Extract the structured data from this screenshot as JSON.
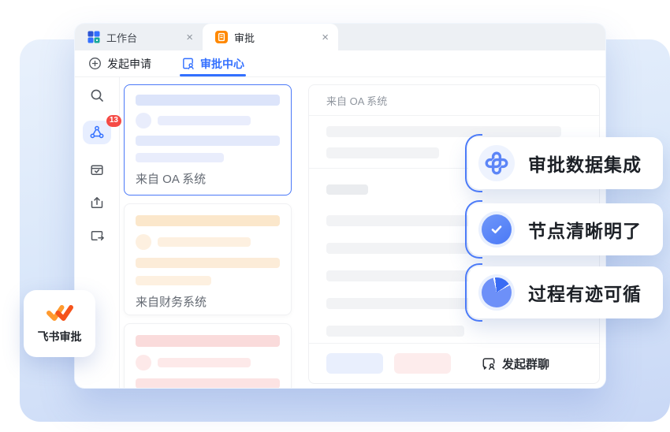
{
  "tabs": {
    "workbench": {
      "label": "工作台",
      "close": "×"
    },
    "approval": {
      "label": "审批",
      "close": "×"
    }
  },
  "subnav": {
    "initiate": {
      "label": "发起申请"
    },
    "center": {
      "label": "审批中心"
    }
  },
  "sidebar": {
    "approval_badge_count": "13"
  },
  "cards": {
    "oa": {
      "caption": "来自 OA 系统"
    },
    "finance": {
      "caption": "来自财务系统"
    }
  },
  "panel": {
    "header": "来自 OA 系统",
    "group_chat_label": "发起群聊"
  },
  "features": [
    {
      "label": "审批数据集成",
      "icon": "integration-icon"
    },
    {
      "label": "节点清晰明了",
      "icon": "check-circle-icon"
    },
    {
      "label": "过程有迹可循",
      "icon": "pie-chart-icon"
    }
  ],
  "app_badge": {
    "label": "飞书审批"
  },
  "colors": {
    "accent_blue": "#3370ff",
    "tab_orange": "#ff8800",
    "badge_red": "#f54a45",
    "card_blue_bar": "#dce4fa",
    "card_orange_bar": "#fbe7cb",
    "card_red_bar": "#fadbdb",
    "gray_bar": "#f2f3f5",
    "bg_gradient_top": "#e9f1fc",
    "bg_gradient_bottom": "#c9d8f6"
  }
}
